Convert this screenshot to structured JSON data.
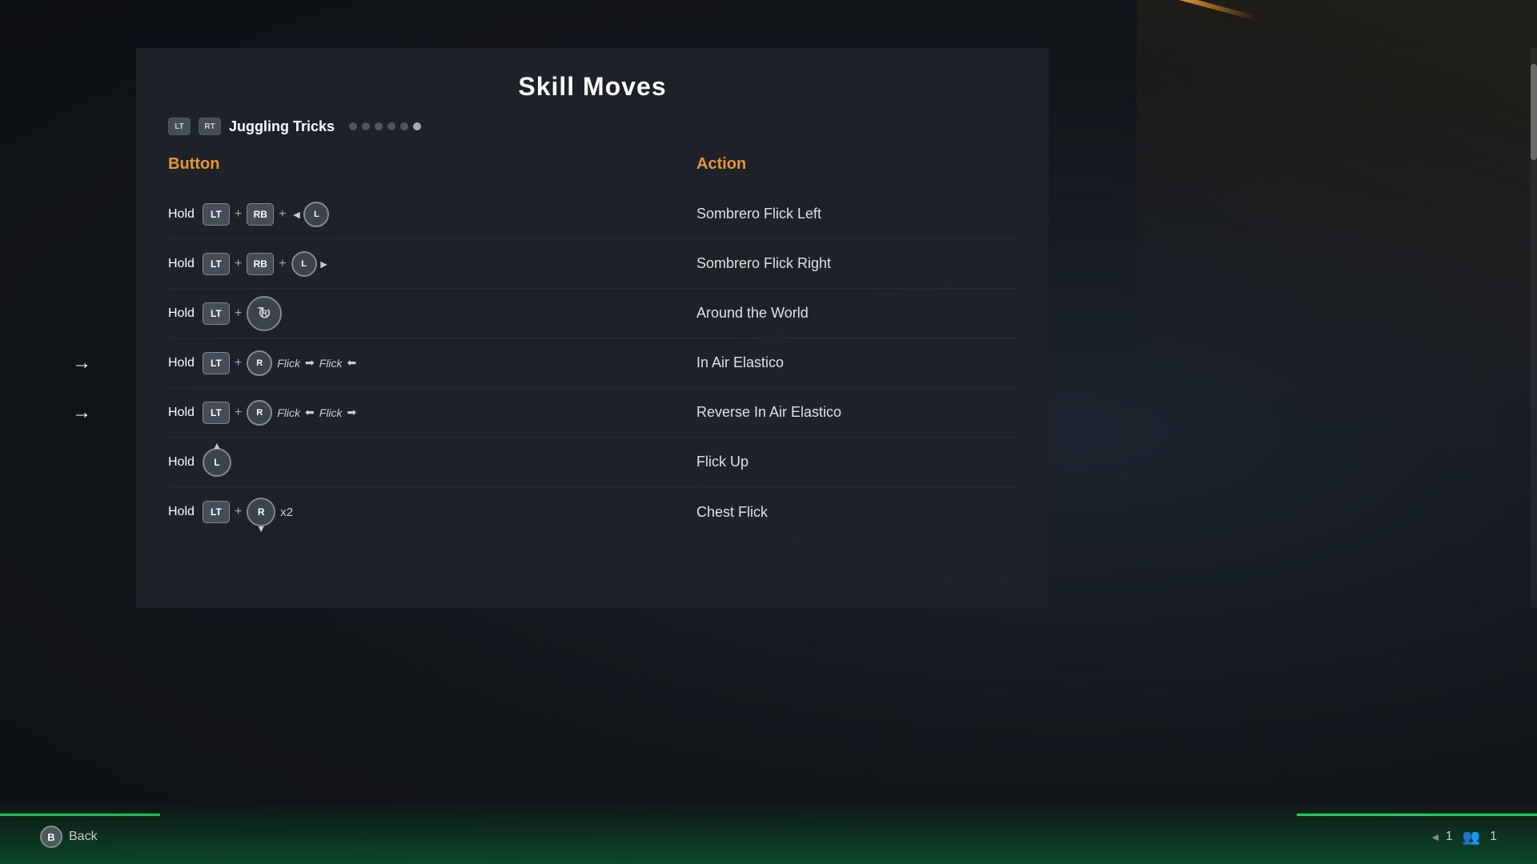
{
  "page": {
    "title": "Skill Moves",
    "background": {
      "accent1": "#4a9fd4",
      "accent2": "#e8962a",
      "accent3": "#00cc50"
    }
  },
  "tab": {
    "lt_label": "LT",
    "rt_label": "RT",
    "name": "Juggling Tricks",
    "dots": [
      {
        "active": false
      },
      {
        "active": false
      },
      {
        "active": false
      },
      {
        "active": false
      },
      {
        "active": false
      },
      {
        "active": true
      }
    ]
  },
  "columns": {
    "button_header": "Button",
    "action_header": "Action"
  },
  "moves": [
    {
      "button_display": "Hold LT + RB + ◄L",
      "action": "Sombrero Flick Left",
      "has_arrow": false
    },
    {
      "button_display": "Hold LT + RB + L►",
      "action": "Sombrero Flick Right",
      "has_arrow": false
    },
    {
      "button_display": "Hold LT + ↻R",
      "action": "Around the World",
      "has_arrow": false
    },
    {
      "button_display": "Hold LT + R Flick ➡ Flick ⬅",
      "action": "In Air Elastico",
      "has_arrow": true
    },
    {
      "button_display": "Hold LT + R Flick ⬅ Flick ➡",
      "action": "Reverse In Air Elastico",
      "has_arrow": true
    },
    {
      "button_display": "Hold ↑L",
      "action": "Flick Up",
      "has_arrow": false
    },
    {
      "button_display": "Hold LT + ↓R x2",
      "action": "Chest Flick",
      "has_arrow": false
    }
  ],
  "bottom": {
    "back_btn_label": "B",
    "back_text": "Back",
    "page_num": "1",
    "users_num": "1"
  }
}
